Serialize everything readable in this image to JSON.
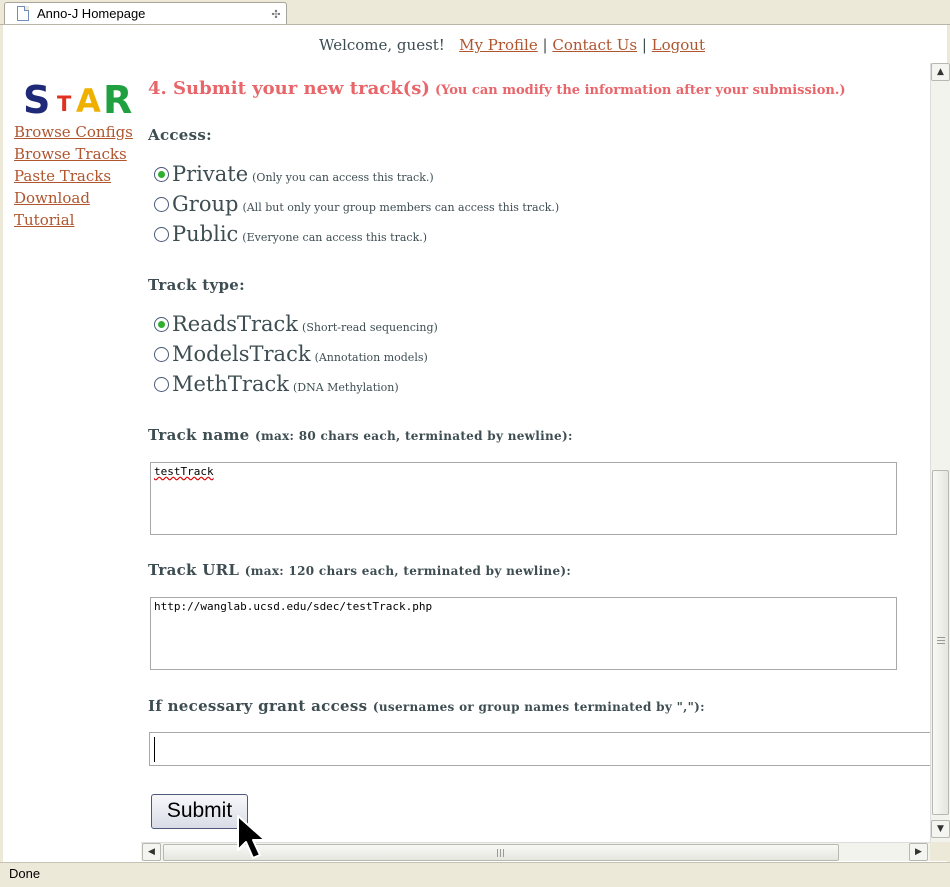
{
  "browser": {
    "tab_title": "Anno-J Homepage",
    "tab_close_icon": "✣",
    "status": "Done"
  },
  "header": {
    "welcome": "Welcome, guest!",
    "links": [
      "My Profile",
      "Contact Us",
      "Logout"
    ],
    "separator": "|"
  },
  "logo": {
    "letters": [
      "S",
      "T",
      "A",
      "R"
    ]
  },
  "sidebar": {
    "items": [
      {
        "label": "Browse Configs"
      },
      {
        "label": "Browse Tracks"
      },
      {
        "label": "Paste Tracks"
      },
      {
        "label": "Download"
      },
      {
        "label": "Tutorial"
      }
    ]
  },
  "form": {
    "heading": "4. Submit your new track(s)",
    "heading_note": "(You can modify the information after your submission.)",
    "access": {
      "label": "Access:",
      "options": [
        {
          "label": "Private",
          "desc": "(Only you can access this track.)",
          "selected": true
        },
        {
          "label": "Group",
          "desc": "(All but only your group members can access this track.)",
          "selected": false
        },
        {
          "label": "Public",
          "desc": "(Everyone can access this track.)",
          "selected": false
        }
      ]
    },
    "track_type": {
      "label": "Track type:",
      "options": [
        {
          "label": "ReadsTrack",
          "desc": "(Short-read sequencing)",
          "selected": true
        },
        {
          "label": "ModelsTrack",
          "desc": "(Annotation models)",
          "selected": false
        },
        {
          "label": "MethTrack",
          "desc": "(DNA Methylation)",
          "selected": false
        }
      ]
    },
    "track_name": {
      "label": "Track name",
      "hint": "(max: 80 chars each, terminated by newline):",
      "value": "testTrack"
    },
    "track_url": {
      "label": "Track URL",
      "hint": "(max: 120 chars each, terminated by newline):",
      "value": "http://wanglab.ucsd.edu/sdec/testTrack.php"
    },
    "grant_access": {
      "label": "If necessary grant access",
      "hint": "(usernames or group names terminated by \",\"):",
      "value": ""
    },
    "submit_label": "Submit"
  },
  "colors": {
    "heading": "#e8656a",
    "link": "#b0552e",
    "text": "#3d4d52",
    "radio_selected": "#2fae2f"
  }
}
